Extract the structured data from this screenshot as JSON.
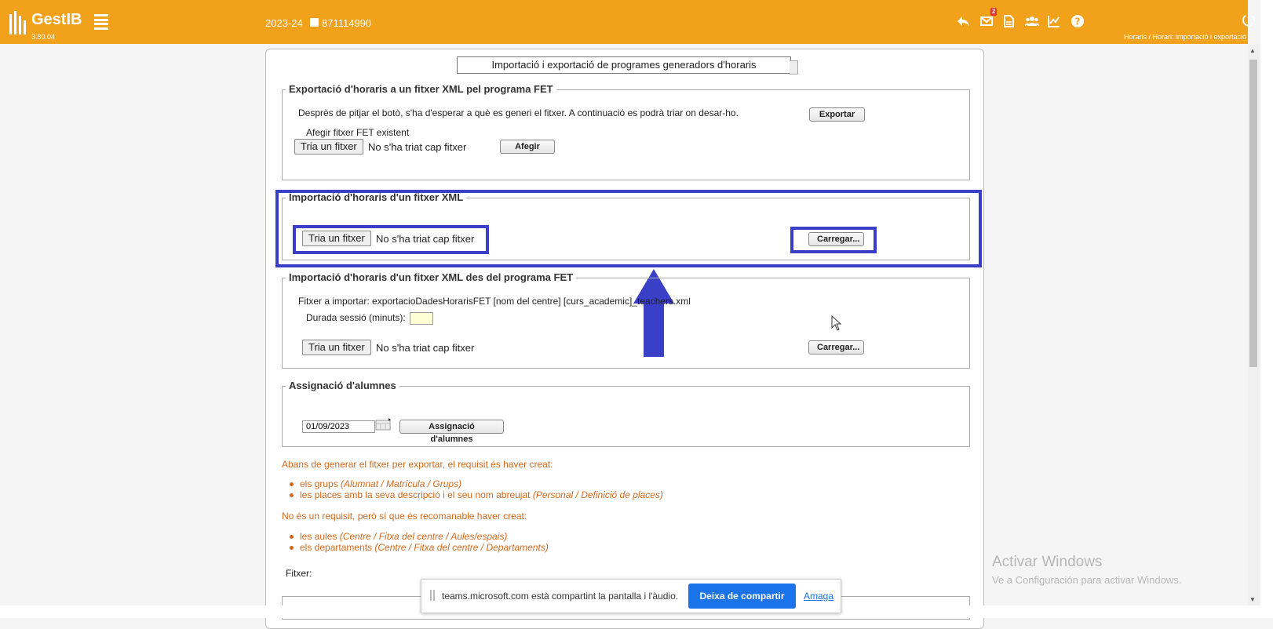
{
  "header": {
    "app_name": "GestIB",
    "version": "3.80.04",
    "year": "2023-24",
    "user_id": "871114990",
    "mail_badge": "2",
    "breadcrumb": "Horaris / Horari: importació i exportació",
    "icons": [
      "logo-icon",
      "menu-icon",
      "back-icon",
      "mail-icon",
      "document-icon",
      "users-icon",
      "chart-icon",
      "help-icon",
      "power-icon"
    ]
  },
  "page": {
    "title": "Importació i exportació de programes generadors d'horaris"
  },
  "export_fet": {
    "legend": "Exportació d'horaris a un fitxer XML pel programa FET",
    "description": "Desprès de pitjar el botò, s'ha d'esperar a què es generi el fitxer. A continuació es podrà triar on desar-ho.",
    "export_button": "Exportar",
    "add_label": "Afegir fitxer FET existent",
    "file_button": "Tria un fitxer",
    "file_status": "No s'ha triat cap fitxer",
    "add_button": "Afegir"
  },
  "import_xml": {
    "legend": "Importació d'horaris d'un fitxer XML",
    "file_button": "Tria un fitxer",
    "file_status": "No s'ha triat cap fitxer",
    "load_button": "Carregar..."
  },
  "import_fet": {
    "legend": "Importació d'horaris d'un fitxer XML des del programa FET",
    "file_info": "Fitxer a importar: exportacioDadesHorarisFET [nom del centre] [curs_academic]_teachers.xml",
    "duration_label": "Durada sessió (minuts):",
    "duration_value": "",
    "file_button": "Tria un fitxer",
    "file_status": "No s'ha triat cap fitxer",
    "load_button": "Carregar..."
  },
  "students": {
    "legend": "Assignació d'alumnes",
    "date": "01/09/2023",
    "assign_button": "Assignació d'alumnes"
  },
  "notes": {
    "required_intro": "Abans de generar el fitxer per exportar, el requisit és haver creat:",
    "required": [
      {
        "text": "els grups ",
        "path": "(Alumnat / Matrícula / Grups)"
      },
      {
        "text": "les places amb la seva descripció i el seu nom abreujat ",
        "path": "(Personal / Definició de places)"
      }
    ],
    "recommended_intro": "No és un requisit, però sí que és recomanable haver creat:",
    "recommended": [
      {
        "text": "les aules ",
        "path": "(Centre / Fitxa del centre / Aules/espais)"
      },
      {
        "text": "els departaments ",
        "path": "(Centre / Fitxa del centre / Departaments)"
      }
    ],
    "file_label": "Fitxer:"
  },
  "watermark": {
    "line1": "Activar Windows",
    "line2": "Ve a Configuración para activar Windows."
  },
  "share_bar": {
    "text": "teams.microsoft.com està compartint la pantalla i l'àudio.",
    "stop_button": "Deixa de compartir",
    "hide_link": "Amaga"
  },
  "colors": {
    "header": "#f2a11b",
    "highlight": "#3a3fc7",
    "note_text": "#d2691e",
    "share_button": "#1a73e8"
  }
}
